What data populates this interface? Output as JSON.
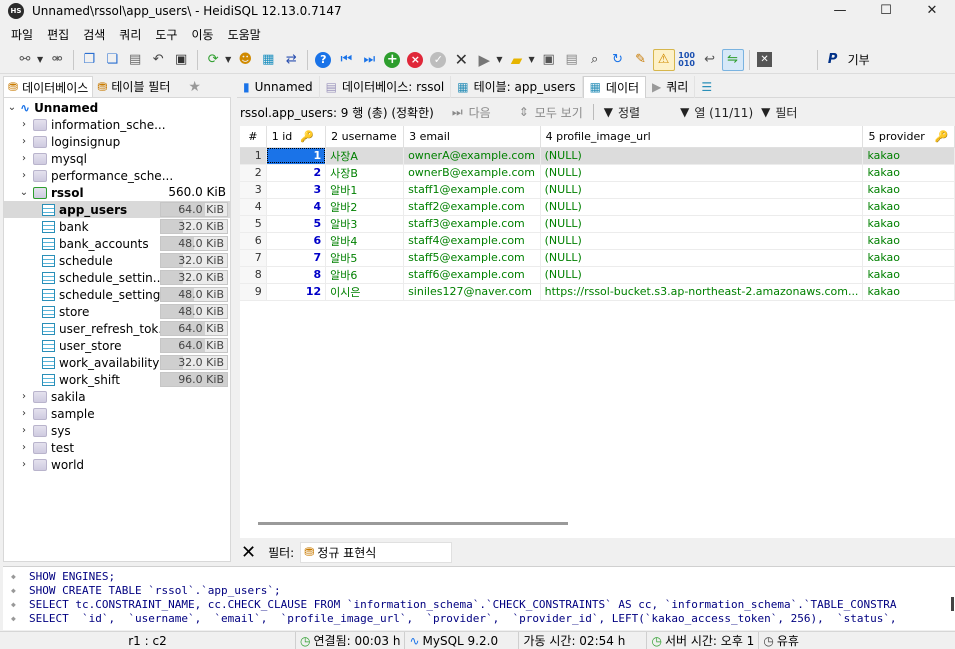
{
  "window": {
    "title": "Unnamed\\rssol\\app_users\\ - HeidiSQL 12.13.0.7147",
    "app_icon_text": "HS",
    "controls": {
      "minimize": "—",
      "maximize": "☐",
      "close": "✕"
    }
  },
  "menu": [
    "파일",
    "편집",
    "검색",
    "쿼리",
    "도구",
    "이동",
    "도움말"
  ],
  "toolbar": {
    "icons": [
      "connect-icon",
      "disconnect-icon",
      "copy-icon",
      "copy-rows-icon",
      "paste-icon",
      "undo-icon",
      "print-icon",
      "refresh-icon",
      "user-manager-icon",
      "export-icon",
      "import-icon",
      "help-icon",
      "first-icon",
      "last-icon",
      "insert-row-icon",
      "delete-row-icon",
      "post-icon",
      "cancel-icon",
      "run-icon",
      "open-file-icon",
      "save-icon",
      "save-as-icon",
      "search-icon",
      "replace-icon",
      "clean-icon",
      "warning-icon",
      "binary-icon",
      "wrap-icon",
      "sync-icon",
      "close-tab-icon",
      "paypal-icon"
    ],
    "donate_label": "기부"
  },
  "left_tabs": [
    {
      "label": "데이터베이스"
    },
    {
      "label": "테이블 필터"
    }
  ],
  "tree": {
    "root": "Unnamed",
    "databases_before": [
      "information_sche...",
      "loginsignup",
      "mysql",
      "performance_sche..."
    ],
    "open_db": {
      "name": "rssol",
      "size": "560.0 KiB"
    },
    "tables": [
      {
        "name": "app_users",
        "size": "64.0 KiB",
        "fill": 0.67
      },
      {
        "name": "bank",
        "size": "32.0 KiB",
        "fill": 0.33
      },
      {
        "name": "bank_accounts",
        "size": "48.0 KiB",
        "fill": 0.5
      },
      {
        "name": "schedule",
        "size": "32.0 KiB",
        "fill": 0.33
      },
      {
        "name": "schedule_settin...",
        "size": "32.0 KiB",
        "fill": 0.33
      },
      {
        "name": "schedule_settings",
        "size": "48.0 KiB",
        "fill": 0.5
      },
      {
        "name": "store",
        "size": "48.0 KiB",
        "fill": 0.5
      },
      {
        "name": "user_refresh_tok...",
        "size": "64.0 KiB",
        "fill": 0.67
      },
      {
        "name": "user_store",
        "size": "64.0 KiB",
        "fill": 0.67
      },
      {
        "name": "work_availability",
        "size": "32.0 KiB",
        "fill": 0.33
      },
      {
        "name": "work_shift",
        "size": "96.0 KiB",
        "fill": 1.0
      }
    ],
    "databases_after": [
      "sakila",
      "sample",
      "sys",
      "test",
      "world"
    ]
  },
  "right_tabs": [
    {
      "label": "Unnamed"
    },
    {
      "label": "데이터베이스: rssol"
    },
    {
      "label": "테이블: app_users"
    },
    {
      "label": "데이터"
    },
    {
      "label": "쿼리"
    }
  ],
  "data_header": {
    "summary": "rssol.app_users: 9 행 (총) (정확한)",
    "next": "다음",
    "show_all": "모두 보기",
    "sort": "정렬",
    "columns": "열 (11/11)",
    "filter": "필터"
  },
  "grid": {
    "columns": [
      {
        "label": "#"
      },
      {
        "label": "1 id"
      },
      {
        "label": "2 username"
      },
      {
        "label": "3 email"
      },
      {
        "label": "4 profile_image_url"
      },
      {
        "label": "5 provider"
      }
    ],
    "rows": [
      {
        "n": "1",
        "id": "1",
        "username": "사장A",
        "email": "ownerA@example.com",
        "profile_image_url": "(NULL)",
        "provider": "kakao"
      },
      {
        "n": "2",
        "id": "2",
        "username": "사장B",
        "email": "ownerB@example.com",
        "profile_image_url": "(NULL)",
        "provider": "kakao"
      },
      {
        "n": "3",
        "id": "3",
        "username": "알바1",
        "email": "staff1@example.com",
        "profile_image_url": "(NULL)",
        "provider": "kakao"
      },
      {
        "n": "4",
        "id": "4",
        "username": "알바2",
        "email": "staff2@example.com",
        "profile_image_url": "(NULL)",
        "provider": "kakao"
      },
      {
        "n": "5",
        "id": "5",
        "username": "알바3",
        "email": "staff3@example.com",
        "profile_image_url": "(NULL)",
        "provider": "kakao"
      },
      {
        "n": "6",
        "id": "6",
        "username": "알바4",
        "email": "staff4@example.com",
        "profile_image_url": "(NULL)",
        "provider": "kakao"
      },
      {
        "n": "7",
        "id": "7",
        "username": "알바5",
        "email": "staff5@example.com",
        "profile_image_url": "(NULL)",
        "provider": "kakao"
      },
      {
        "n": "8",
        "id": "8",
        "username": "알바6",
        "email": "staff6@example.com",
        "profile_image_url": "(NULL)",
        "provider": "kakao"
      },
      {
        "n": "9",
        "id": "12",
        "username": "이시은",
        "email": "siniles127@naver.com",
        "profile_image_url": "https://rssol-bucket.s3.ap-northeast-2.amazonaws.com...",
        "provider": "kakao"
      }
    ]
  },
  "filter_bar": {
    "label": "필터:",
    "regex_label": "정규 표현식"
  },
  "sql_log": [
    "SHOW ENGINES;",
    "SHOW CREATE TABLE `rssol`.`app_users`;",
    "SELECT tc.CONSTRAINT_NAME, cc.CHECK_CLAUSE FROM `information_schema`.`CHECK_CONSTRAINTS` AS cc, `information_schema`.`TABLE_CONSTRA",
    "SELECT  `id`,  `username`,  `email`,  `profile_image_url`,  `provider`,  `provider_id`, LEFT(`kakao_access_token`, 256),  `status`,"
  ],
  "status_bar": {
    "cursor": "r1 : c2",
    "connected": "연결됨: 00:03 h",
    "server": "MySQL 9.2.0",
    "uptime": "가동 시간: 02:54 h",
    "server_time": "서버 시간: 오후 1",
    "idle": "유휴"
  },
  "colors": {
    "id_blue": "#0000c8",
    "string_green": "#008000",
    "selected_cell": "#1a73e8"
  }
}
